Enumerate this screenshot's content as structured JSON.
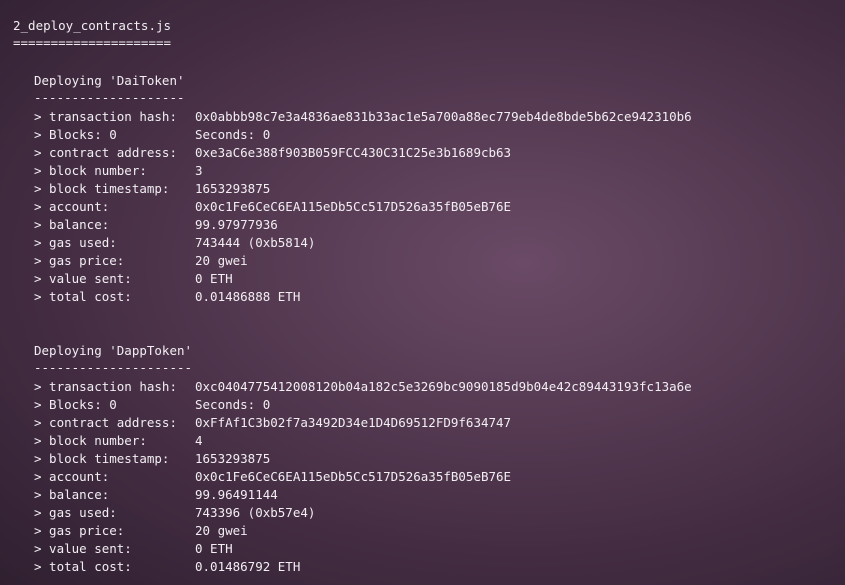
{
  "file_header": {
    "title": "2_deploy_contracts.js",
    "underline": "====================="
  },
  "deployments": [
    {
      "title": "Deploying 'DaiToken'",
      "underline": "--------------------",
      "rows": [
        {
          "key": "> transaction hash:",
          "value": "0x0abbb98c7e3a4836ae831b33ac1e5a700a88ec779eb4de8bde5b62ce942310b6"
        },
        {
          "key": "> Blocks: 0",
          "value": "Seconds: 0"
        },
        {
          "key": "> contract address:",
          "value": "0xe3aC6e388f903B059FCC430C31C25e3b1689cb63"
        },
        {
          "key": "> block number:",
          "value": "3"
        },
        {
          "key": "> block timestamp:",
          "value": "1653293875"
        },
        {
          "key": "> account:",
          "value": "0x0c1Fe6CeC6EA115eDb5Cc517D526a35fB05eB76E"
        },
        {
          "key": "> balance:",
          "value": "99.97977936"
        },
        {
          "key": "> gas used:",
          "value": "743444 (0xb5814)"
        },
        {
          "key": "> gas price:",
          "value": "20 gwei"
        },
        {
          "key": "> value sent:",
          "value": "0 ETH"
        },
        {
          "key": "> total cost:",
          "value": "0.01486888 ETH"
        }
      ]
    },
    {
      "title": "Deploying 'DappToken'",
      "underline": "---------------------",
      "rows": [
        {
          "key": "> transaction hash:",
          "value": "0xc0404775412008120b04a182c5e3269bc9090185d9b04e42c89443193fc13a6e"
        },
        {
          "key": "> Blocks: 0",
          "value": "Seconds: 0"
        },
        {
          "key": "> contract address:",
          "value": "0xFfAf1C3b02f7a3492D34e1D4D69512FD9f634747"
        },
        {
          "key": "> block number:",
          "value": "4"
        },
        {
          "key": "> block timestamp:",
          "value": "1653293875"
        },
        {
          "key": "> account:",
          "value": "0x0c1Fe6CeC6EA115eDb5Cc517D526a35fB05eB76E"
        },
        {
          "key": "> balance:",
          "value": "99.96491144"
        },
        {
          "key": "> gas used:",
          "value": "743396 (0xb57e4)"
        },
        {
          "key": "> gas price:",
          "value": "20 gwei"
        },
        {
          "key": "> value sent:",
          "value": "0 ETH"
        },
        {
          "key": "> total cost:",
          "value": "0.01486792 ETH"
        }
      ]
    }
  ]
}
